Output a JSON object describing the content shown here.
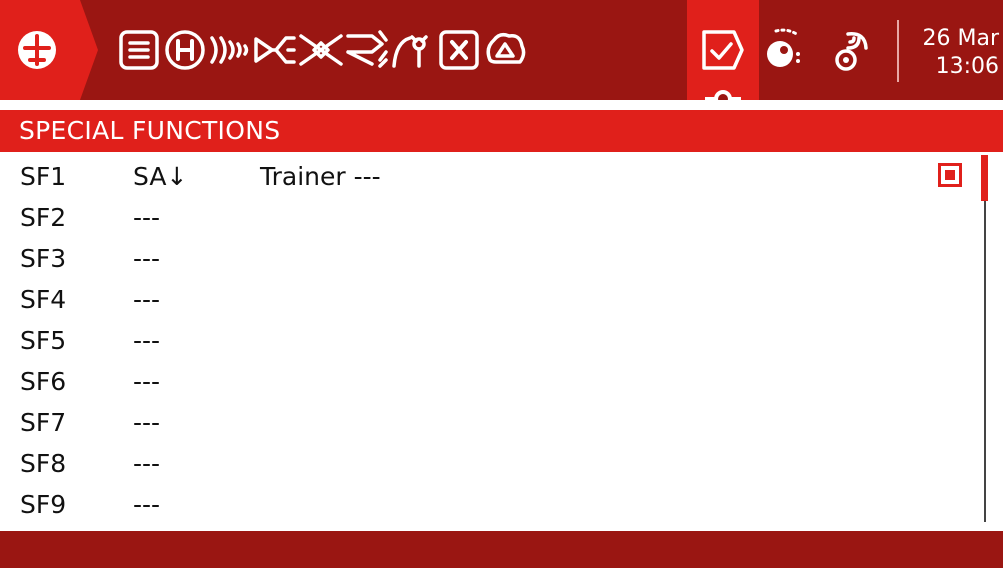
{
  "topbar": {
    "icons": [
      {
        "name": "model-menu-icon"
      },
      {
        "name": "model-setup-icon"
      },
      {
        "name": "heli-setup-icon"
      },
      {
        "name": "flight-modes-icon"
      },
      {
        "name": "inputs-icon"
      },
      {
        "name": "mixes-icon"
      },
      {
        "name": "outputs-icon"
      },
      {
        "name": "curves-icon"
      },
      {
        "name": "global-variables-icon"
      },
      {
        "name": "logical-switches-icon"
      },
      {
        "name": "special-functions-icon"
      },
      {
        "name": "lua-scripts-icon"
      },
      {
        "name": "telemetry-icon"
      }
    ],
    "active_tab": "special-functions",
    "date": "26 Mar",
    "time": "13:06"
  },
  "page": {
    "title": "SPECIAL FUNCTIONS"
  },
  "rows": [
    {
      "id": "SF1",
      "switch": "SA↓",
      "function": "Trainer ---",
      "enabled": true
    },
    {
      "id": "SF2",
      "switch": "---",
      "function": ""
    },
    {
      "id": "SF3",
      "switch": "---",
      "function": ""
    },
    {
      "id": "SF4",
      "switch": "---",
      "function": ""
    },
    {
      "id": "SF5",
      "switch": "---",
      "function": ""
    },
    {
      "id": "SF6",
      "switch": "---",
      "function": ""
    },
    {
      "id": "SF7",
      "switch": "---",
      "function": ""
    },
    {
      "id": "SF8",
      "switch": "---",
      "function": ""
    },
    {
      "id": "SF9",
      "switch": "---",
      "function": ""
    }
  ],
  "colors": {
    "accent": "#e0201b",
    "dark": "#9a1612",
    "text": "#111111",
    "background": "#ffffff"
  }
}
